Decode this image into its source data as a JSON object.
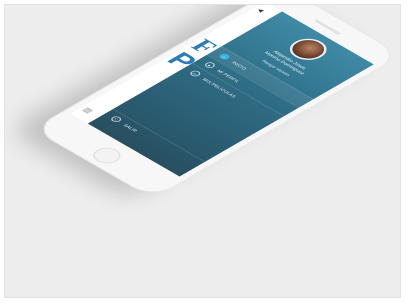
{
  "drawer": {
    "user_name_line1": "Alejandro Jesús",
    "user_name_line2": "Moreno Domínguez",
    "profile_link": "Ranger Venero",
    "menu": [
      {
        "label": "INICIO",
        "icon": "home-icon",
        "active": true
      },
      {
        "label": "MI PERFIL",
        "icon": "user-icon",
        "active": false
      },
      {
        "label": "MIS PELÍCULAS",
        "icon": "film-icon",
        "active": false
      }
    ],
    "logout_label": "SALIR"
  },
  "colors": {
    "drawer_top": "#3f8aa6",
    "drawer_bottom": "#284f60",
    "active_icon": "#37b4e0",
    "brand": "#2b7bb9"
  }
}
